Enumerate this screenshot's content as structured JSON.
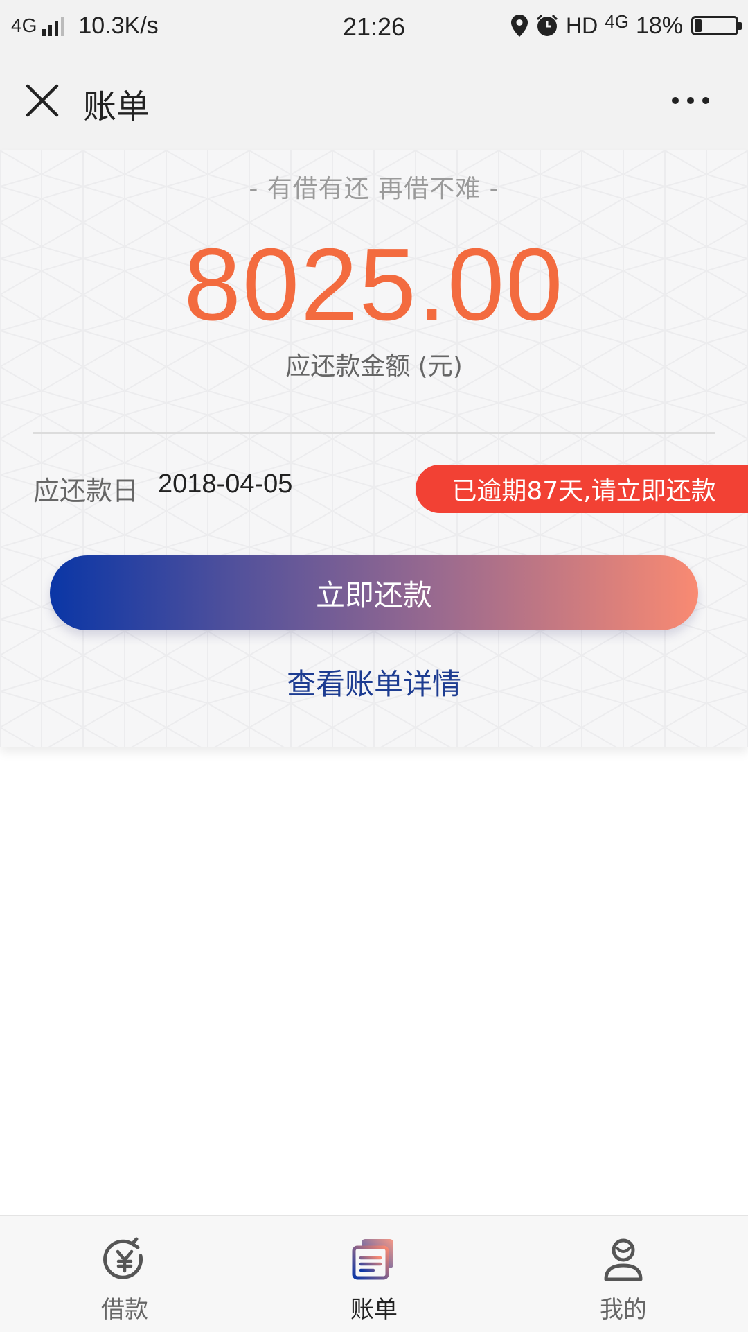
{
  "status_bar": {
    "signal_label": "4G",
    "net_speed": "10.3K/s",
    "time": "21:26",
    "hd": "HD",
    "network_4g": "4G",
    "battery": "18%"
  },
  "nav": {
    "title": "账单",
    "close_icon": "close-icon",
    "more_icon": "more-icon"
  },
  "bill": {
    "slogan": "- 有借有还 再借不难 -",
    "amount": "8025.00",
    "amount_label": "应还款金额 (元)",
    "due_label": "应还款日",
    "due_date": "2018-04-05",
    "overdue_notice": "已逾期87天,请立即还款",
    "pay_button": "立即还款",
    "detail_link": "查看账单详情"
  },
  "colors": {
    "amount": "#f36b3f",
    "overdue": "#f24134",
    "link": "#1d3c91",
    "gradient_start": "#0a36a6",
    "gradient_end": "#f98a72"
  },
  "tabs": [
    {
      "label": "借款",
      "icon": "loan-icon",
      "active": false
    },
    {
      "label": "账单",
      "icon": "bill-icon",
      "active": true
    },
    {
      "label": "我的",
      "icon": "profile-icon",
      "active": false
    }
  ]
}
